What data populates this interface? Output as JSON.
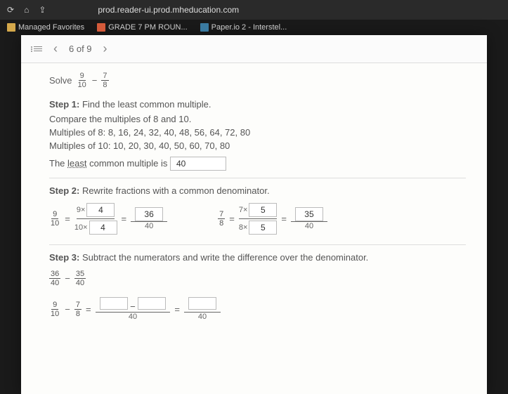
{
  "browser": {
    "url": "prod.reader-ui.prod.mheducation.com",
    "bookmarks": [
      {
        "label": "Managed Favorites"
      },
      {
        "label": "GRADE 7 PM ROUN..."
      },
      {
        "label": "Paper.io 2 - Interstel..."
      }
    ]
  },
  "nav": {
    "position": "6 of 9"
  },
  "problem": {
    "prompt_word": "Solve",
    "frac1_n": "9",
    "frac1_d": "10",
    "op": "−",
    "frac2_n": "7",
    "frac2_d": "8"
  },
  "step1": {
    "title": "Step 1:",
    "text": "Find the least common multiple.",
    "compare": "Compare the multiples of 8 and 10.",
    "mult8": "Multiples of 8: 8, 16, 24, 32, 40, 48, 56, 64, 72, 80",
    "mult10": "Multiples of 10: 10, 20, 30, 40, 50, 60, 70, 80",
    "lcm_sentence_a": "The ",
    "lcm_word": "least",
    "lcm_sentence_b": " common multiple is",
    "lcm_value": "40"
  },
  "step2": {
    "title": "Step 2:",
    "text": "Rewrite fractions with a common denominator.",
    "left": {
      "orig_n": "9",
      "orig_d": "10",
      "mult_n": "9×",
      "mult_d": "10×",
      "factor_top": "4",
      "factor_bot": "4",
      "result_n": "36",
      "result_d": "40"
    },
    "right": {
      "orig_n": "7",
      "orig_d": "8",
      "mult_n": "7×",
      "mult_d": "8×",
      "factor_top": "5",
      "factor_bot": "5",
      "result_n": "35",
      "result_d": "40"
    }
  },
  "step3": {
    "title": "Step 3:",
    "text": "Subtract the numerators and write the difference over the denominator.",
    "line1": {
      "a_n": "36",
      "a_d": "40",
      "b_n": "35",
      "b_d": "40",
      "op": "−"
    },
    "line2": {
      "a_n": "9",
      "a_d": "10",
      "b_n": "7",
      "b_d": "8",
      "op": "−",
      "mid_d": "40",
      "res_d": "40",
      "box_a": "",
      "box_b": "",
      "box_c": ""
    }
  }
}
